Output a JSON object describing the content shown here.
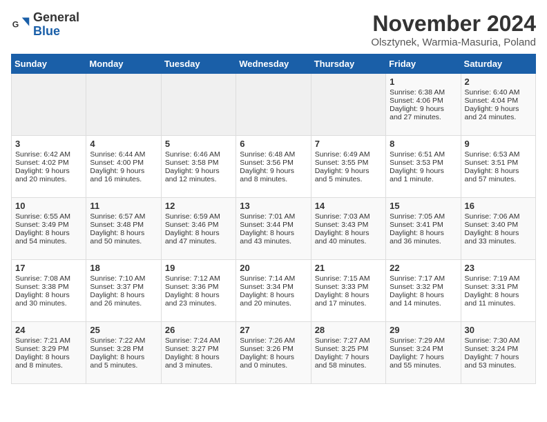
{
  "logo": {
    "general": "General",
    "blue": "Blue"
  },
  "header": {
    "month": "November 2024",
    "location": "Olsztynek, Warmia-Masuria, Poland"
  },
  "days_of_week": [
    "Sunday",
    "Monday",
    "Tuesday",
    "Wednesday",
    "Thursday",
    "Friday",
    "Saturday"
  ],
  "weeks": [
    [
      {
        "day": "",
        "content": ""
      },
      {
        "day": "",
        "content": ""
      },
      {
        "day": "",
        "content": ""
      },
      {
        "day": "",
        "content": ""
      },
      {
        "day": "",
        "content": ""
      },
      {
        "day": "1",
        "content": "Sunrise: 6:38 AM\nSunset: 4:06 PM\nDaylight: 9 hours and 27 minutes."
      },
      {
        "day": "2",
        "content": "Sunrise: 6:40 AM\nSunset: 4:04 PM\nDaylight: 9 hours and 24 minutes."
      }
    ],
    [
      {
        "day": "3",
        "content": "Sunrise: 6:42 AM\nSunset: 4:02 PM\nDaylight: 9 hours and 20 minutes."
      },
      {
        "day": "4",
        "content": "Sunrise: 6:44 AM\nSunset: 4:00 PM\nDaylight: 9 hours and 16 minutes."
      },
      {
        "day": "5",
        "content": "Sunrise: 6:46 AM\nSunset: 3:58 PM\nDaylight: 9 hours and 12 minutes."
      },
      {
        "day": "6",
        "content": "Sunrise: 6:48 AM\nSunset: 3:56 PM\nDaylight: 9 hours and 8 minutes."
      },
      {
        "day": "7",
        "content": "Sunrise: 6:49 AM\nSunset: 3:55 PM\nDaylight: 9 hours and 5 minutes."
      },
      {
        "day": "8",
        "content": "Sunrise: 6:51 AM\nSunset: 3:53 PM\nDaylight: 9 hours and 1 minute."
      },
      {
        "day": "9",
        "content": "Sunrise: 6:53 AM\nSunset: 3:51 PM\nDaylight: 8 hours and 57 minutes."
      }
    ],
    [
      {
        "day": "10",
        "content": "Sunrise: 6:55 AM\nSunset: 3:49 PM\nDaylight: 8 hours and 54 minutes."
      },
      {
        "day": "11",
        "content": "Sunrise: 6:57 AM\nSunset: 3:48 PM\nDaylight: 8 hours and 50 minutes."
      },
      {
        "day": "12",
        "content": "Sunrise: 6:59 AM\nSunset: 3:46 PM\nDaylight: 8 hours and 47 minutes."
      },
      {
        "day": "13",
        "content": "Sunrise: 7:01 AM\nSunset: 3:44 PM\nDaylight: 8 hours and 43 minutes."
      },
      {
        "day": "14",
        "content": "Sunrise: 7:03 AM\nSunset: 3:43 PM\nDaylight: 8 hours and 40 minutes."
      },
      {
        "day": "15",
        "content": "Sunrise: 7:05 AM\nSunset: 3:41 PM\nDaylight: 8 hours and 36 minutes."
      },
      {
        "day": "16",
        "content": "Sunrise: 7:06 AM\nSunset: 3:40 PM\nDaylight: 8 hours and 33 minutes."
      }
    ],
    [
      {
        "day": "17",
        "content": "Sunrise: 7:08 AM\nSunset: 3:38 PM\nDaylight: 8 hours and 30 minutes."
      },
      {
        "day": "18",
        "content": "Sunrise: 7:10 AM\nSunset: 3:37 PM\nDaylight: 8 hours and 26 minutes."
      },
      {
        "day": "19",
        "content": "Sunrise: 7:12 AM\nSunset: 3:36 PM\nDaylight: 8 hours and 23 minutes."
      },
      {
        "day": "20",
        "content": "Sunrise: 7:14 AM\nSunset: 3:34 PM\nDaylight: 8 hours and 20 minutes."
      },
      {
        "day": "21",
        "content": "Sunrise: 7:15 AM\nSunset: 3:33 PM\nDaylight: 8 hours and 17 minutes."
      },
      {
        "day": "22",
        "content": "Sunrise: 7:17 AM\nSunset: 3:32 PM\nDaylight: 8 hours and 14 minutes."
      },
      {
        "day": "23",
        "content": "Sunrise: 7:19 AM\nSunset: 3:31 PM\nDaylight: 8 hours and 11 minutes."
      }
    ],
    [
      {
        "day": "24",
        "content": "Sunrise: 7:21 AM\nSunset: 3:29 PM\nDaylight: 8 hours and 8 minutes."
      },
      {
        "day": "25",
        "content": "Sunrise: 7:22 AM\nSunset: 3:28 PM\nDaylight: 8 hours and 5 minutes."
      },
      {
        "day": "26",
        "content": "Sunrise: 7:24 AM\nSunset: 3:27 PM\nDaylight: 8 hours and 3 minutes."
      },
      {
        "day": "27",
        "content": "Sunrise: 7:26 AM\nSunset: 3:26 PM\nDaylight: 8 hours and 0 minutes."
      },
      {
        "day": "28",
        "content": "Sunrise: 7:27 AM\nSunset: 3:25 PM\nDaylight: 7 hours and 58 minutes."
      },
      {
        "day": "29",
        "content": "Sunrise: 7:29 AM\nSunset: 3:24 PM\nDaylight: 7 hours and 55 minutes."
      },
      {
        "day": "30",
        "content": "Sunrise: 7:30 AM\nSunset: 3:24 PM\nDaylight: 7 hours and 53 minutes."
      }
    ]
  ]
}
